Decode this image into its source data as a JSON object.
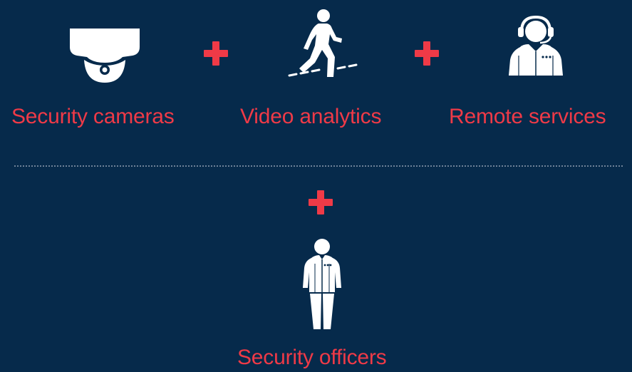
{
  "colors": {
    "background": "#062a4b",
    "accent": "#ef3a47",
    "icon": "#ffffff",
    "divider": "#6f8298"
  },
  "items": [
    {
      "label": "Security cameras",
      "icon": "security-camera-icon"
    },
    {
      "label": "Video analytics",
      "icon": "walking-person-icon"
    },
    {
      "label": "Remote services",
      "icon": "headset-operator-icon"
    },
    {
      "label": "Security officers",
      "icon": "security-officer-icon"
    }
  ],
  "connector_symbol": "plus-icon"
}
